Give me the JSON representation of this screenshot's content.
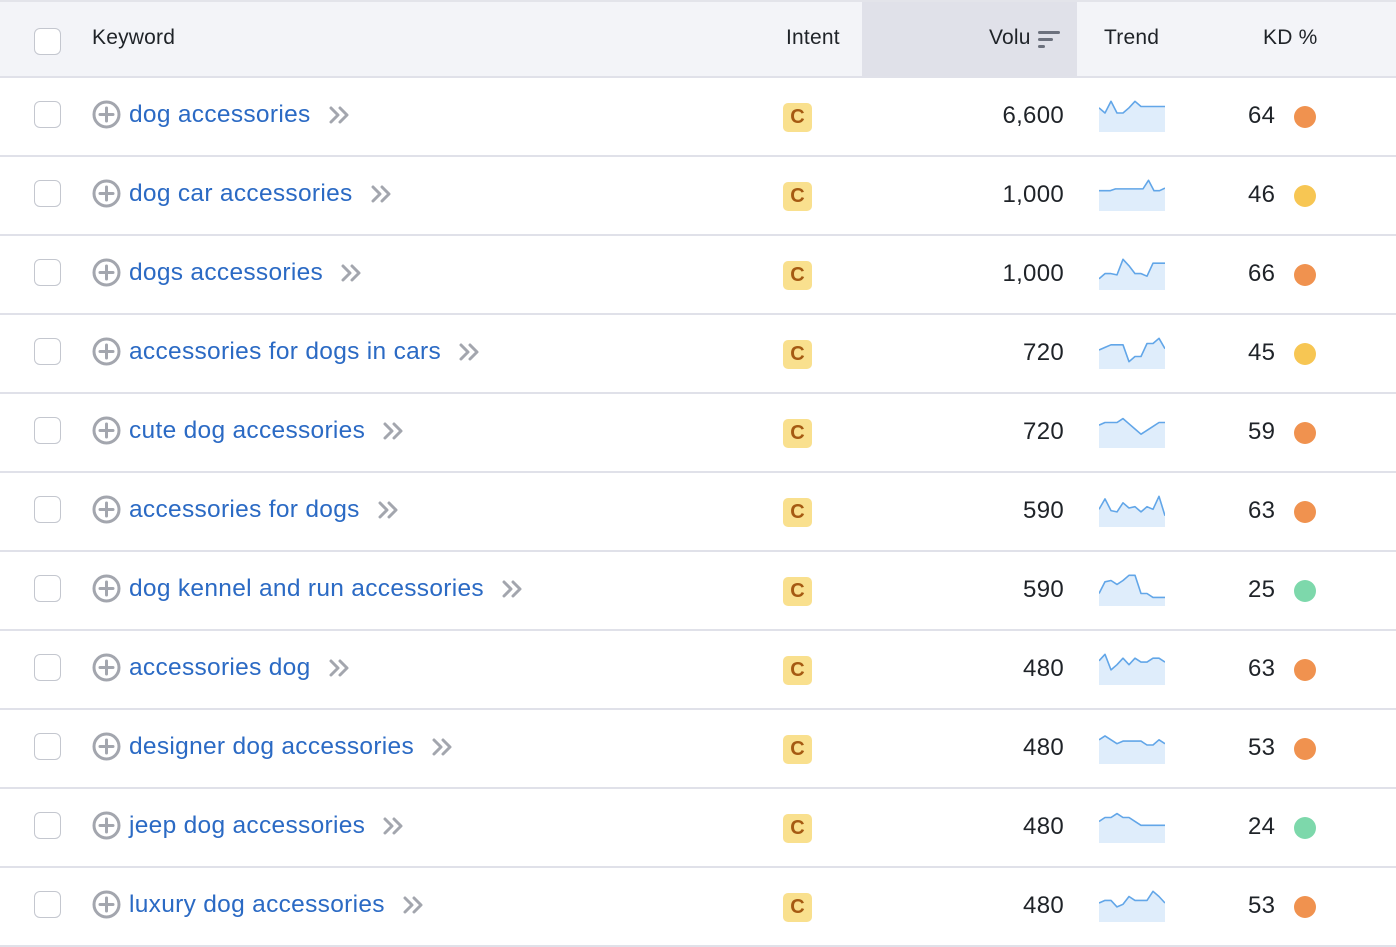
{
  "header": {
    "select_all_checked": false,
    "columns": {
      "keyword": "Keyword",
      "intent": "Intent",
      "volume": "Volu",
      "trend": "Trend",
      "kd": "KD %"
    },
    "sorted_column": "volume",
    "sort_icon": "sort-descending-icon"
  },
  "colors": {
    "link": "#2b6ac4",
    "intent_bg": "#f9e08e",
    "intent_fg": "#a55a12",
    "trend_line": "#62a6e8",
    "trend_fill": "#dfedfb",
    "kd_orange": "#f0924f",
    "kd_yellow": "#f7c653",
    "kd_green": "#7dd8ab"
  },
  "rows": [
    {
      "keyword": "dog accessories",
      "intent": "C",
      "volume": "6,600",
      "kd": "64",
      "kd_level": "orange",
      "trend": [
        0.7,
        0.5,
        0.95,
        0.5,
        0.5,
        0.7,
        0.95,
        0.75,
        0.75,
        0.75,
        0.75,
        0.75
      ]
    },
    {
      "keyword": "dog car accessories",
      "intent": "C",
      "volume": "1,000",
      "kd": "46",
      "kd_level": "yellow",
      "trend": [
        0.55,
        0.55,
        0.55,
        0.62,
        0.62,
        0.62,
        0.62,
        0.62,
        0.62,
        0.95,
        0.55,
        0.55,
        0.65
      ]
    },
    {
      "keyword": "dogs accessories",
      "intent": "C",
      "volume": "1,000",
      "kd": "66",
      "kd_level": "orange",
      "trend": [
        0.2,
        0.4,
        0.4,
        0.35,
        0.95,
        0.7,
        0.4,
        0.4,
        0.3,
        0.8,
        0.8,
        0.8
      ]
    },
    {
      "keyword": "accessories for dogs in cars",
      "intent": "C",
      "volume": "720",
      "kd": "45",
      "kd_level": "yellow",
      "trend": [
        0.5,
        0.6,
        0.7,
        0.7,
        0.7,
        0.05,
        0.25,
        0.25,
        0.75,
        0.75,
        0.95,
        0.55
      ]
    },
    {
      "keyword": "cute dog accessories",
      "intent": "C",
      "volume": "720",
      "kd": "59",
      "kd_level": "orange",
      "trend": [
        0.65,
        0.75,
        0.75,
        0.75,
        0.9,
        0.7,
        0.5,
        0.3,
        0.45,
        0.6,
        0.75,
        0.75
      ]
    },
    {
      "keyword": "accessories for dogs",
      "intent": "C",
      "volume": "590",
      "kd": "63",
      "kd_level": "orange",
      "trend": [
        0.45,
        0.85,
        0.4,
        0.35,
        0.7,
        0.5,
        0.55,
        0.35,
        0.55,
        0.45,
        0.95,
        0.2
      ]
    },
    {
      "keyword": "dog kennel and run accessories",
      "intent": "C",
      "volume": "590",
      "kd": "25",
      "kd_level": "green",
      "trend": [
        0.25,
        0.7,
        0.75,
        0.6,
        0.75,
        0.95,
        0.95,
        0.25,
        0.25,
        0.1,
        0.1,
        0.1
      ]
    },
    {
      "keyword": "accessories dog",
      "intent": "C",
      "volume": "480",
      "kd": "63",
      "kd_level": "orange",
      "trend": [
        0.7,
        0.95,
        0.35,
        0.55,
        0.8,
        0.55,
        0.8,
        0.65,
        0.65,
        0.8,
        0.8,
        0.65
      ]
    },
    {
      "keyword": "designer dog accessories",
      "intent": "C",
      "volume": "480",
      "kd": "53",
      "kd_level": "orange",
      "trend": [
        0.7,
        0.85,
        0.7,
        0.55,
        0.65,
        0.65,
        0.65,
        0.65,
        0.5,
        0.5,
        0.7,
        0.55
      ]
    },
    {
      "keyword": "jeep dog accessories",
      "intent": "C",
      "volume": "480",
      "kd": "24",
      "kd_level": "green",
      "trend": [
        0.6,
        0.75,
        0.75,
        0.9,
        0.75,
        0.75,
        0.6,
        0.45,
        0.45,
        0.45,
        0.45,
        0.45
      ]
    },
    {
      "keyword": "luxury dog accessories",
      "intent": "C",
      "volume": "480",
      "kd": "53",
      "kd_level": "orange",
      "trend": [
        0.5,
        0.6,
        0.6,
        0.35,
        0.45,
        0.75,
        0.6,
        0.6,
        0.6,
        0.95,
        0.75,
        0.5
      ]
    }
  ]
}
